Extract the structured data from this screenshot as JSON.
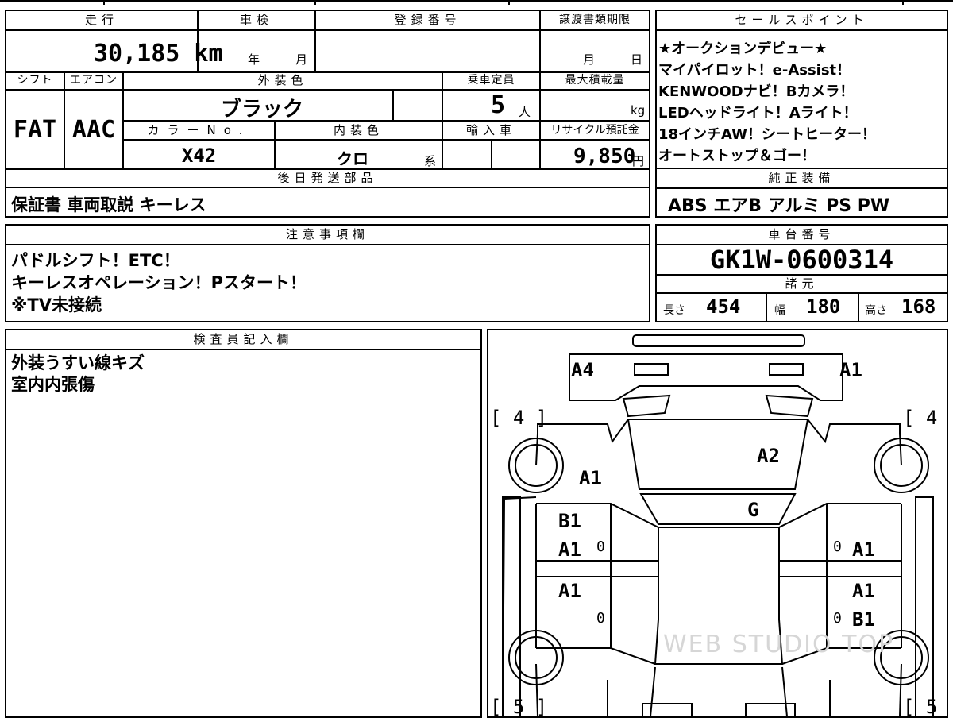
{
  "headers": {
    "mileage": "走行",
    "inspection": "車検",
    "registration": "登録番号",
    "transfer_deadline": "譲渡書類期限",
    "sales_points": "セールスポイント",
    "shift": "シフト",
    "aircon": "エアコン",
    "exterior_color": "外装色",
    "capacity": "乗車定員",
    "max_load": "最大積載量",
    "color_no": "カラーNo.",
    "interior_color": "内装色",
    "import": "輸入車",
    "recycle": "リサイクル預託金",
    "later_parts": "後日発送部品",
    "factory_equipment": "純正装備",
    "notes": "注意事項欄",
    "chassis": "車台番号",
    "specs": "諸元",
    "inspector": "検査員記入欄"
  },
  "values": {
    "mileage": "30,185 km",
    "inspection_year_unit": "年",
    "inspection_month_unit": "月",
    "transfer_month_unit": "月",
    "transfer_day_unit": "日",
    "shift": "FAT",
    "aircon": "AAC",
    "exterior_color": "ブラック",
    "capacity": "5",
    "capacity_unit": "人",
    "load_unit": "kg",
    "color_no": "X42",
    "interior_color": "クロ",
    "interior_suffix": "系",
    "recycle": "9,850",
    "recycle_unit": "円",
    "later_parts": "保証書 車両取説 キーレス",
    "factory_equipment": "ABS エアB アルミ PS PW",
    "chassis": "GK1W-0600314",
    "length_label": "長さ",
    "length": "454",
    "width_label": "幅",
    "width": "180",
    "height_label": "高さ",
    "height": "168"
  },
  "sales_points": [
    "★オークションデビュー★",
    "マイパイロット！e-Assist！",
    "KENWOODナビ！Bカメラ！",
    "LEDヘッドライト！Aライト！",
    "18インチAW！シートヒーター！",
    "オートストップ＆ゴー！"
  ],
  "notes": [
    "パドルシフト！ETC！",
    "キーレスオペレーション！Pスタート！",
    "※TV未接続"
  ],
  "inspector": [
    "外装うすい線キズ",
    "室内内張傷"
  ],
  "diagram": {
    "tire_front_left": "[ 4 ]",
    "tire_front_right": "[ 4 ]",
    "tire_rear_left": "[ 5 ]",
    "tire_rear_right": "[ 5 ]",
    "front_left": "A4",
    "front_right": "A1",
    "hood": "A2",
    "left_fender": "A1",
    "windshield": "G",
    "left_front_door_1": "B1",
    "left_front_door_2": "A1",
    "left_rear_door": "A1",
    "right_front_door": "A1",
    "right_rear_door_1": "A1",
    "right_rear_door_2": "B1",
    "zero": "0"
  },
  "watermark": "WEB STUDIO TOP"
}
